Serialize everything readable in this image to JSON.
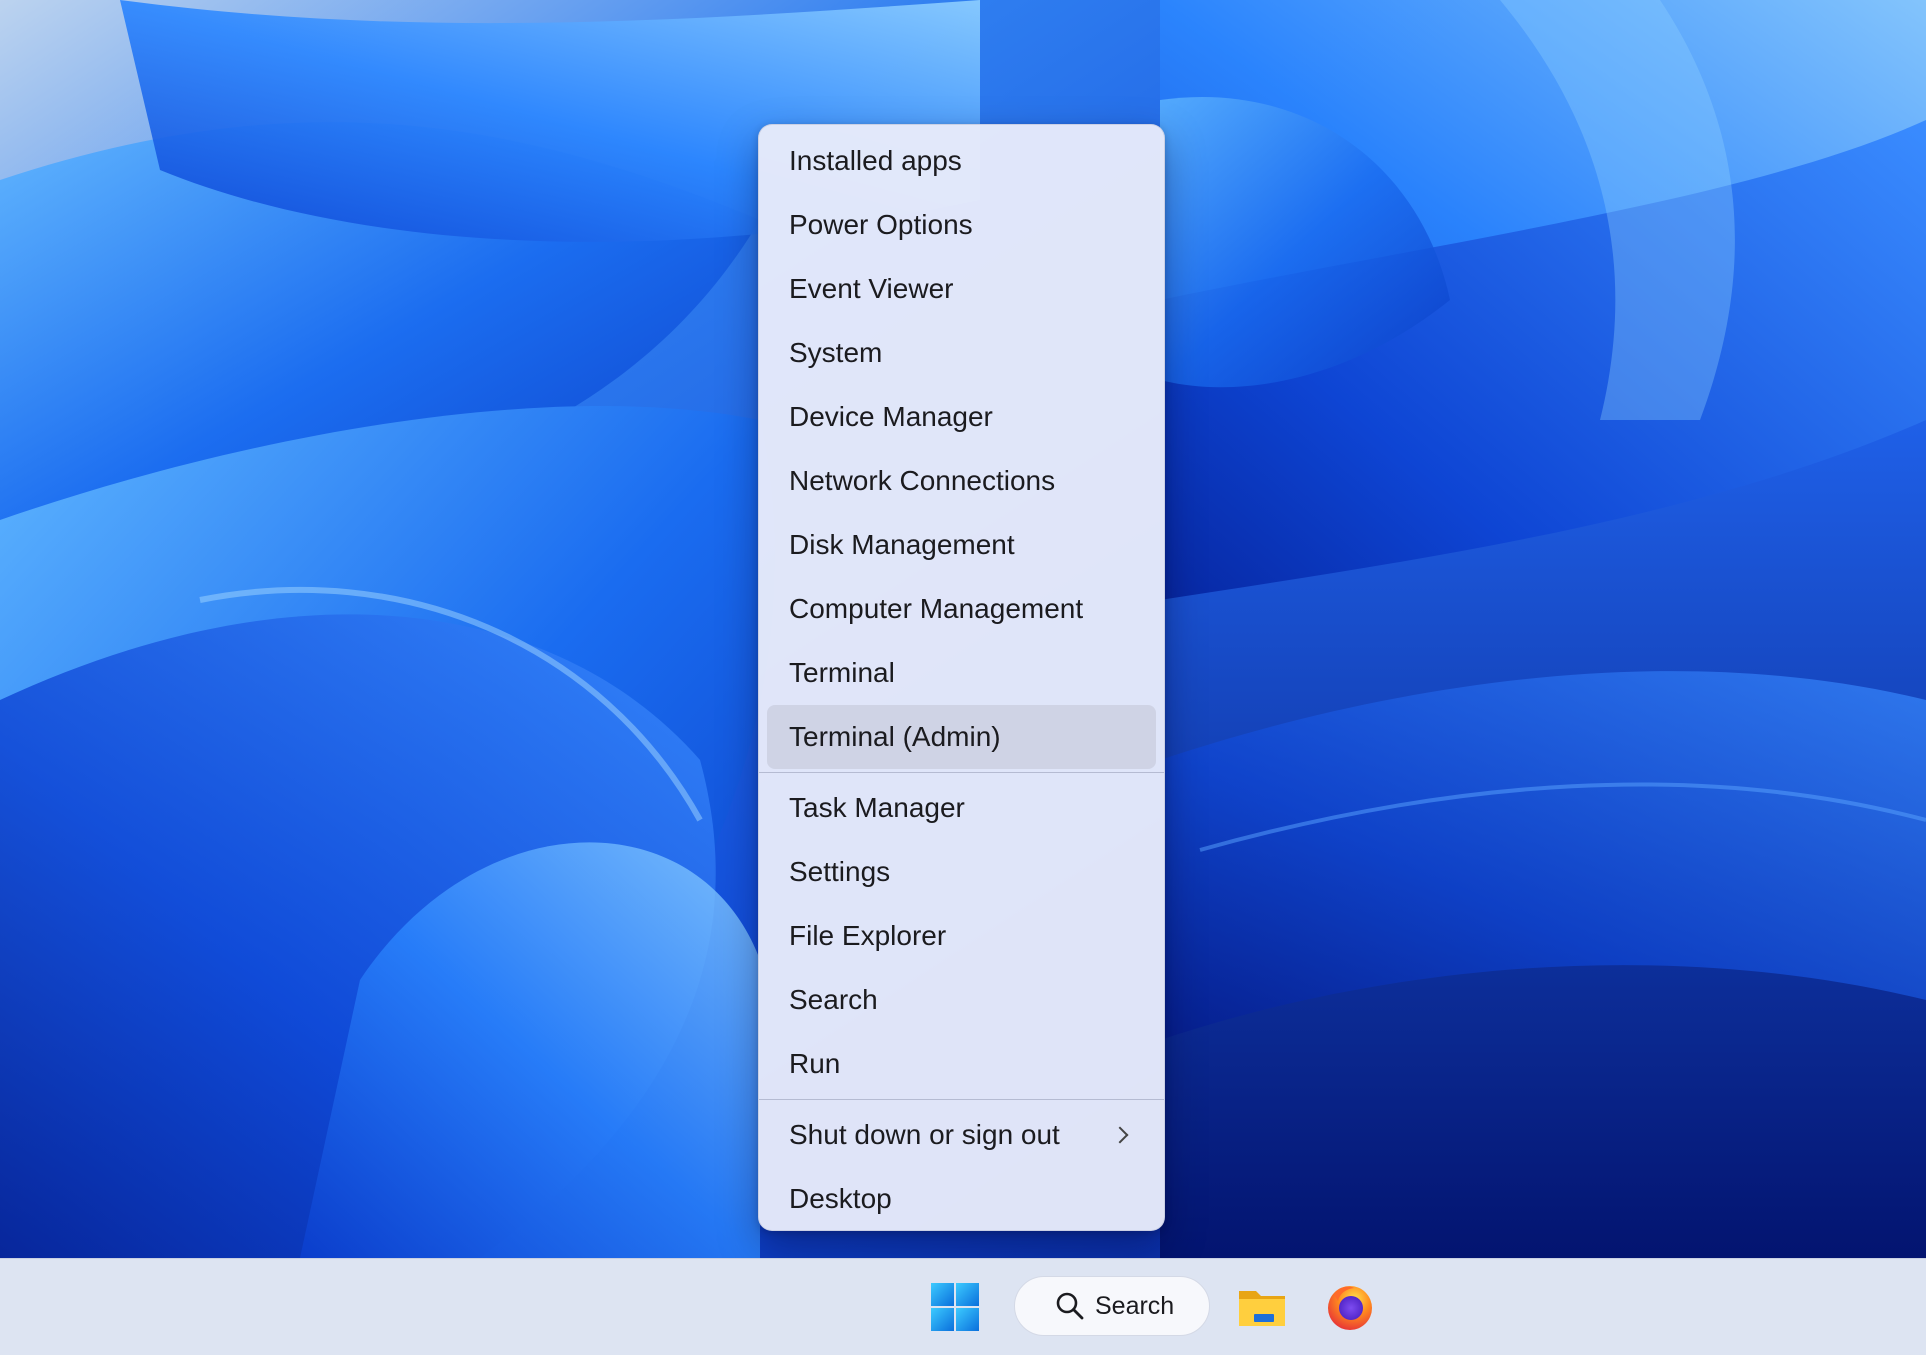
{
  "context_menu": {
    "group1": [
      {
        "label": "Installed apps"
      },
      {
        "label": "Power Options"
      },
      {
        "label": "Event Viewer"
      },
      {
        "label": "System"
      },
      {
        "label": "Device Manager"
      },
      {
        "label": "Network Connections"
      },
      {
        "label": "Disk Management"
      },
      {
        "label": "Computer Management"
      },
      {
        "label": "Terminal"
      },
      {
        "label": "Terminal (Admin)",
        "hovered": true
      }
    ],
    "group2": [
      {
        "label": "Task Manager"
      },
      {
        "label": "Settings"
      },
      {
        "label": "File Explorer"
      },
      {
        "label": "Search"
      },
      {
        "label": "Run"
      }
    ],
    "group3": [
      {
        "label": "Shut down or sign out",
        "has_submenu": true,
        "submenu_icon": "chevron-right-icon"
      },
      {
        "label": "Desktop"
      }
    ]
  },
  "taskbar": {
    "start_icon": "windows-logo-icon",
    "search": {
      "label": "Search",
      "icon": "search-icon"
    },
    "apps": [
      {
        "name": "File Explorer",
        "icon": "folder-icon"
      },
      {
        "name": "Firefox",
        "icon": "firefox-icon"
      }
    ]
  },
  "colors": {
    "wallpaper_blue": "#1a5ae0",
    "menu_background": "#e8ebfa",
    "menu_hover": "#cdd2e4",
    "taskbar_background": "#dde4f2"
  }
}
